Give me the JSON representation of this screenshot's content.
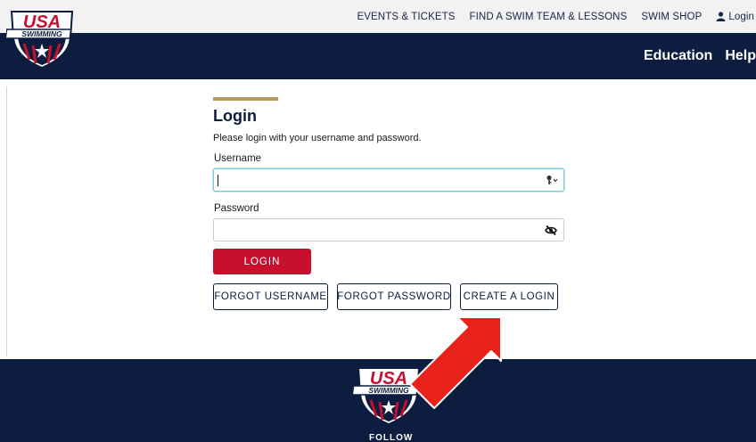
{
  "brand": {
    "logo_top": "USA",
    "logo_bottom": "SWIMMING"
  },
  "topnav": {
    "events": "EVENTS & TICKETS",
    "find_team": "FIND A SWIM TEAM & LESSONS",
    "shop": "SWIM SHOP",
    "login": "Login"
  },
  "mainnav": {
    "education": "Education",
    "help": "Help"
  },
  "login": {
    "title": "Login",
    "subtitle": "Please login with your username and password.",
    "username_label": "Username",
    "username_value": "",
    "password_label": "Password",
    "password_value": "",
    "login_button": "LOGIN",
    "forgot_username": "FORGOT USERNAME",
    "forgot_password": "FORGOT PASSWORD",
    "create_login": "CREATE A LOGIN"
  },
  "footer": {
    "follow": "FOLLOW"
  },
  "colors": {
    "navy": "#0c1d3f",
    "red": "#c8102e",
    "gold": "#b7975a",
    "annotation_arrow": "#e8221b"
  }
}
